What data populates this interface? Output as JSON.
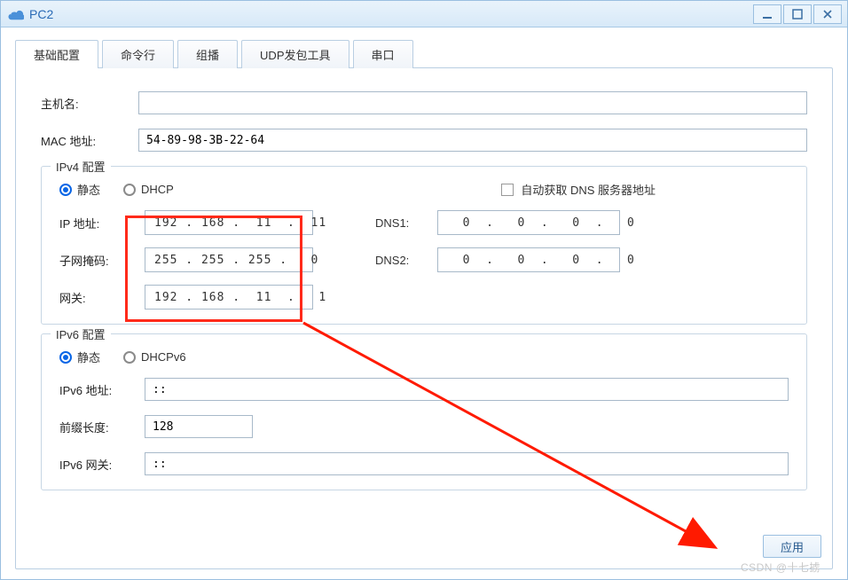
{
  "window": {
    "title": "PC2"
  },
  "tabs": {
    "basic": "基础配置",
    "cli": "命令行",
    "multicast": "组播",
    "udp": "UDP发包工具",
    "serial": "串口"
  },
  "fields": {
    "hostname_label": "主机名:",
    "hostname_value": "",
    "mac_label": "MAC 地址:",
    "mac_value": "54-89-98-3B-22-64"
  },
  "ipv4": {
    "legend": "IPv4 配置",
    "static_label": "静态",
    "dhcp_label": "DHCP",
    "auto_dns_label": "自动获取 DNS 服务器地址",
    "ip_label": "IP 地址:",
    "ip_value": "192 . 168 .  11  .  11",
    "mask_label": "子网掩码:",
    "mask_value": "255 . 255 . 255 .   0",
    "gw_label": "网关:",
    "gw_value": "192 . 168 .  11  .   1",
    "dns1_label": "DNS1:",
    "dns1_value": "  0  .   0  .   0  .   0",
    "dns2_label": "DNS2:",
    "dns2_value": "  0  .   0  .   0  .   0"
  },
  "ipv6": {
    "legend": "IPv6 配置",
    "static_label": "静态",
    "dhcpv6_label": "DHCPv6",
    "addr_label": "IPv6 地址:",
    "addr_value": "::",
    "prefix_label": "前缀长度:",
    "prefix_value": "128",
    "gw_label": "IPv6 网关:",
    "gw_value": "::"
  },
  "buttons": {
    "apply": "应用"
  },
  "watermark": "CSDN @十七掳"
}
